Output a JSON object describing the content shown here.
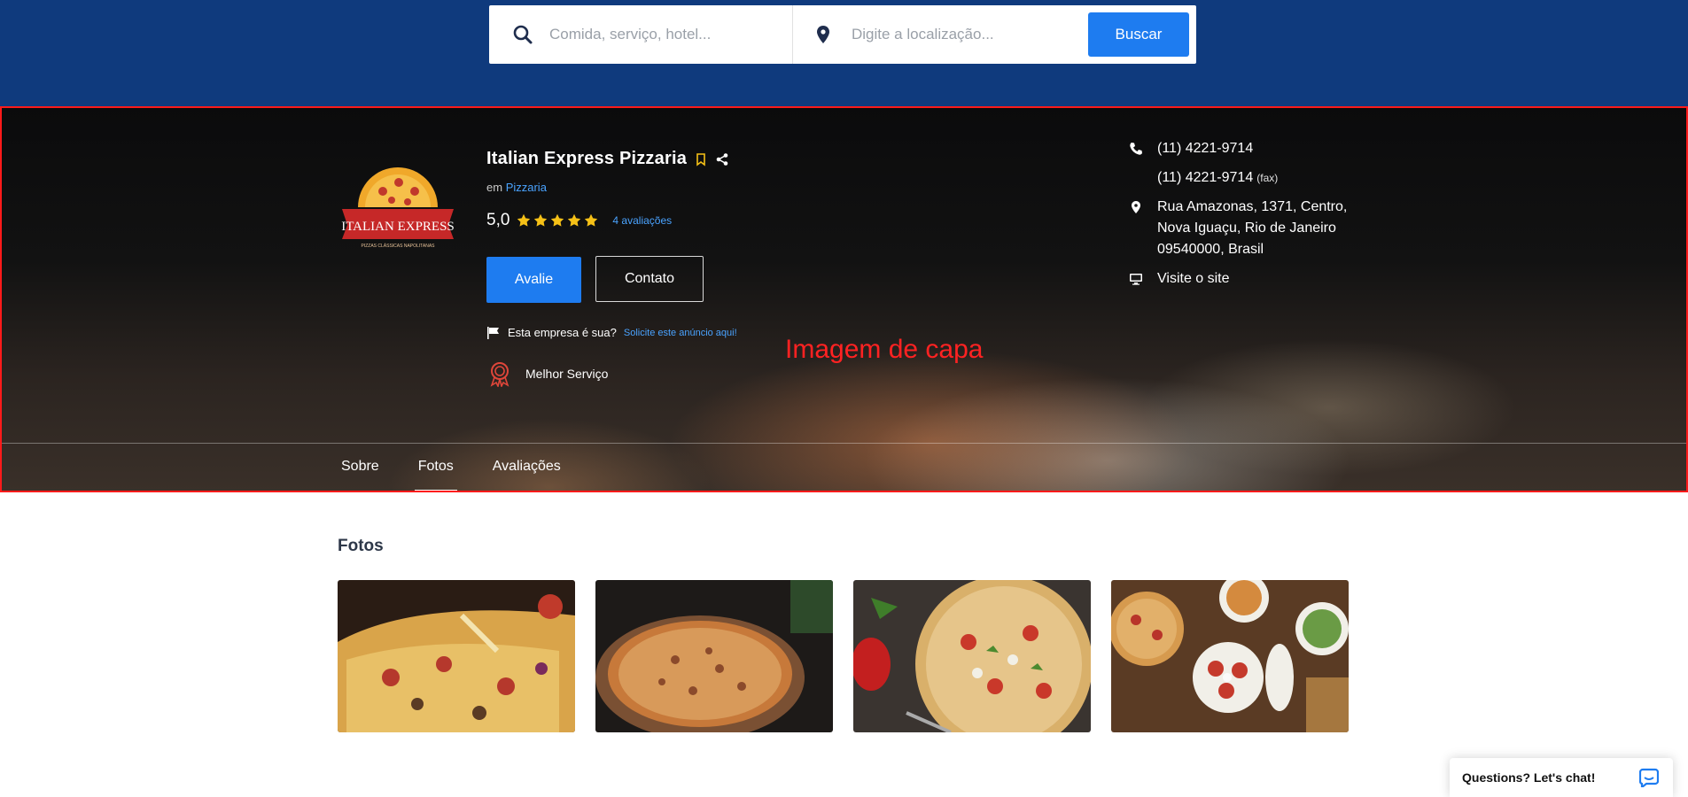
{
  "search": {
    "what_placeholder": "Comida, serviço, hotel...",
    "where_placeholder": "Digite a localização...",
    "button_label": "Buscar"
  },
  "business": {
    "name": "Italian Express Pizzaria",
    "category_prefix": "em",
    "category": "Pizzaria",
    "rating": "5,0",
    "stars": 5,
    "reviews_link": "4 avaliações",
    "btn_rate": "Avalie",
    "btn_contact": "Contato",
    "claim_question": "Esta empresa é sua?",
    "claim_link": "Solicite este anúncio aqui!",
    "badge": "Melhor Serviço",
    "logo_text": "ITALIAN EXPRESS",
    "logo_subtext": "PIZZAS CLÁSSICAS NAPOLITANAS"
  },
  "cover_label": "Imagem de capa",
  "contact": {
    "phone": "(11) 4221-9714",
    "fax_number": "(11) 4221-9714",
    "fax_suffix": "(fax)",
    "address": "Rua Amazonas, 1371, Centro, Nova Iguaçu, Rio de Janeiro 09540000, Brasil",
    "website": "Visite o site"
  },
  "tabs": [
    {
      "label": "Sobre",
      "active": false
    },
    {
      "label": "Fotos",
      "active": true
    },
    {
      "label": "Avaliações",
      "active": false
    }
  ],
  "photos_section": {
    "title": "Fotos",
    "photos": [
      {
        "name": "pizza-slice-photo"
      },
      {
        "name": "whole-pizza-photo"
      },
      {
        "name": "pizza-with-tomatoes-photo"
      },
      {
        "name": "pizza-table-photo"
      }
    ]
  },
  "chat": {
    "label": "Questions? Let's chat!"
  },
  "colors": {
    "top_band": "#0f3a7d",
    "accent_blue": "#1e7cf0",
    "link_blue": "#4aa3ff",
    "star_gold": "#f6c117",
    "highlight_red": "#ff1a1a"
  }
}
